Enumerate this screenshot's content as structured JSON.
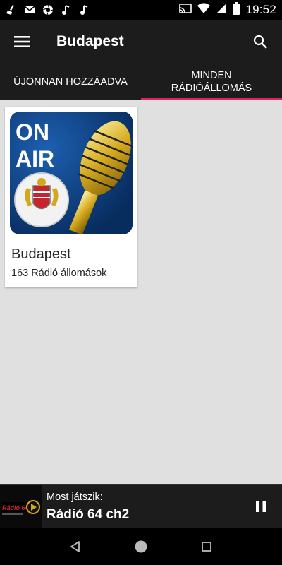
{
  "status_bar": {
    "time": "19:52",
    "icons": [
      "broom-icon",
      "gmail-icon",
      "aperture-icon",
      "music-note-icon",
      "music-note-icon",
      "cast-icon",
      "wifi-icon",
      "signal-icon",
      "battery-icon"
    ]
  },
  "app_bar": {
    "title": "Budapest",
    "menu_icon": "hamburger-menu-icon",
    "search_icon": "search-icon"
  },
  "tabs": [
    {
      "label": "ÚJONNAN HOZZÁADVA",
      "active": false
    },
    {
      "label_line1": "MINDEN",
      "label_line2": "RÁDIÓÁLLOMÁS",
      "active": true
    }
  ],
  "accent_color": "#e0245e",
  "cards": [
    {
      "title": "Budapest",
      "subtitle": "163 Rádió állomások",
      "art_text_line1": "ON",
      "art_text_line2": "AIR"
    }
  ],
  "player": {
    "label": "Most játszik:",
    "station": "Rádió 64 ch2",
    "pause_icon": "pause-icon"
  },
  "nav_bar": {
    "icons": [
      "back-icon",
      "home-icon",
      "recents-icon"
    ]
  }
}
